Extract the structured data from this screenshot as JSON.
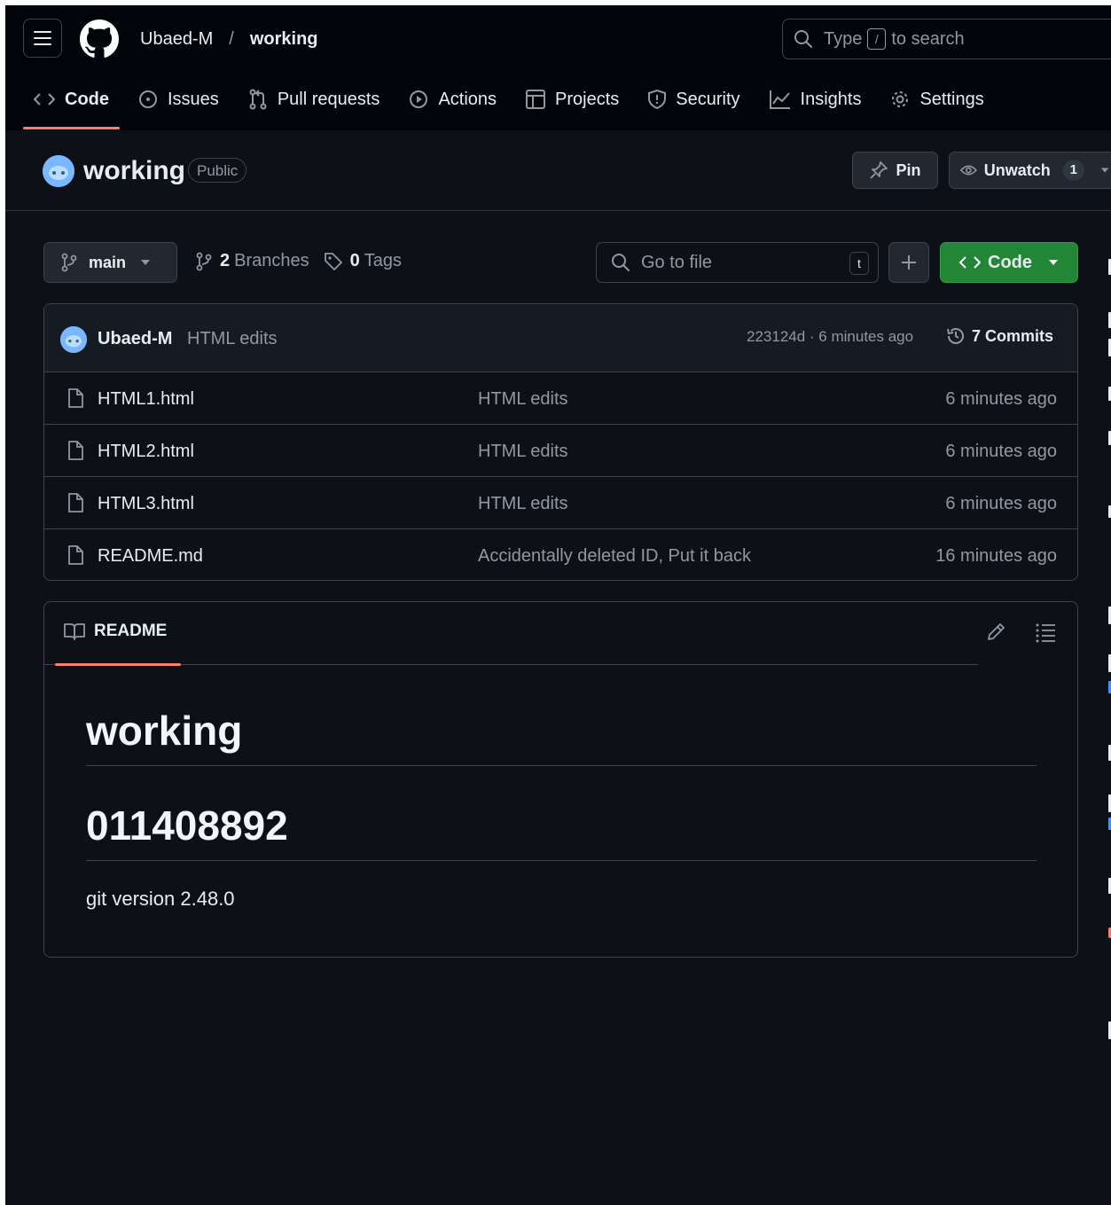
{
  "header": {
    "owner": "Ubaed-M",
    "separator": "/",
    "repo": "working",
    "search": {
      "before": "Type",
      "key": "/",
      "after": "to search"
    }
  },
  "tabs": [
    {
      "label": "Code",
      "icon": "code-icon",
      "selected": true
    },
    {
      "label": "Issues",
      "icon": "issue-opened-icon"
    },
    {
      "label": "Pull requests",
      "icon": "git-pull-request-icon"
    },
    {
      "label": "Actions",
      "icon": "play-icon"
    },
    {
      "label": "Projects",
      "icon": "table-icon"
    },
    {
      "label": "Security",
      "icon": "shield-icon"
    },
    {
      "label": "Insights",
      "icon": "graph-icon"
    },
    {
      "label": "Settings",
      "icon": "gear-icon"
    }
  ],
  "repo_header": {
    "title": "working",
    "visibility": "Public",
    "pin_label": "Pin",
    "watch_label": "Unwatch",
    "watch_count": "1"
  },
  "file_nav": {
    "branch": "main",
    "branches_count": "2",
    "branches_label": "Branches",
    "tags_count": "0",
    "tags_label": "Tags",
    "goto_placeholder": "Go to file",
    "goto_key": "t",
    "code_label": "Code"
  },
  "latest_commit": {
    "author": "Ubaed-M",
    "message": "HTML edits",
    "info": "223124d · 6 minutes ago",
    "commits_label": "7 Commits"
  },
  "files": [
    {
      "name": "HTML1.html",
      "message": "HTML edits",
      "date": "6 minutes ago"
    },
    {
      "name": "HTML2.html",
      "message": "HTML edits",
      "date": "6 minutes ago"
    },
    {
      "name": "HTML3.html",
      "message": "HTML edits",
      "date": "6 minutes ago"
    },
    {
      "name": "README.md",
      "message": "Accidentally deleted ID, Put it back",
      "date": "16 minutes ago"
    }
  ],
  "readme": {
    "tab_label": "README",
    "h1": "working",
    "h2": "011408892",
    "paragraph": "git version 2.48.0"
  },
  "colors": {
    "background": "#0d1117",
    "header_bg": "#010409",
    "accent_underline": "#f78166",
    "code_button": "#238636",
    "muted_text": "#9198a1"
  }
}
